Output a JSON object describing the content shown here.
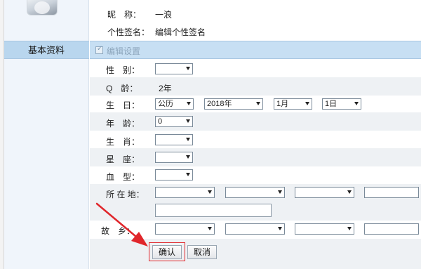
{
  "header": {
    "nickname_label": "昵　称：",
    "nickname_value": "一浪",
    "signature_label": "个性签名：",
    "signature_value": "编辑个性签名"
  },
  "sidebar": {
    "items": [
      {
        "label": "基本资料"
      }
    ]
  },
  "section": {
    "label": "编辑设置"
  },
  "form": {
    "gender_label": "性　别：",
    "gender_value": "",
    "qage_label": "Q　龄：",
    "qage_value": "2年",
    "birthday_label": "生　日：",
    "calendar_value": "公历",
    "year_value": "2018年",
    "month_value": "1月",
    "day_value": "1日",
    "age_label": "年　龄：",
    "age_value": "0",
    "zodiac_label": "生　肖：",
    "zodiac_value": "",
    "constellation_label": "星　座：",
    "constellation_value": "",
    "blood_label": "血　型：",
    "blood_value": "",
    "location_label": "所 在 地：",
    "location_values": [
      "",
      "",
      "",
      ""
    ],
    "address_value": "",
    "hometown_label": "故　乡：",
    "hometown_values": [
      "",
      "",
      "",
      ""
    ]
  },
  "buttons": {
    "confirm": "确认",
    "cancel": "取消"
  },
  "colors": {
    "highlight": "#e0262b",
    "section_bar": "#c7dff3",
    "sidebar_selected": "#b9d6ee"
  },
  "icons": {
    "section_check": "checkbox-icon",
    "dropdown": "chevron-down-icon",
    "annotation": "red-arrow"
  }
}
